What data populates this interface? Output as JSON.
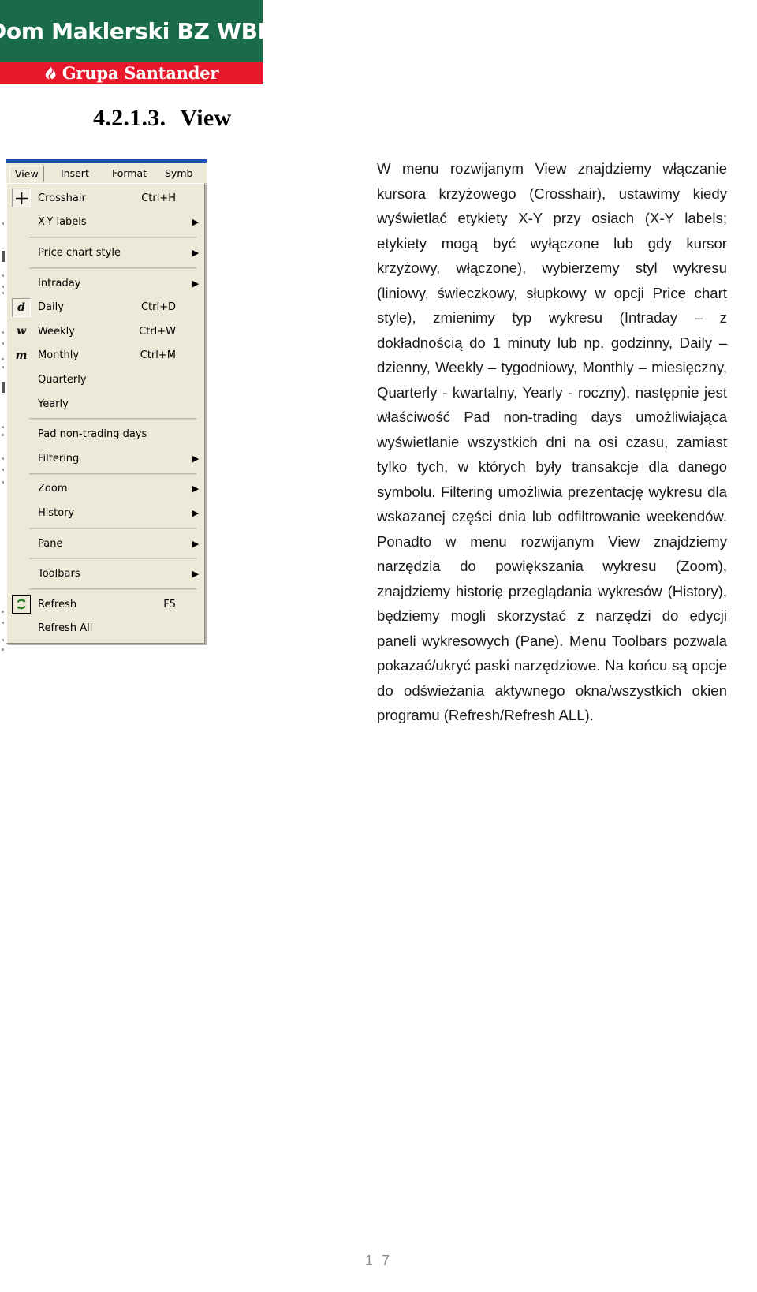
{
  "logo": {
    "green_text": "Dom Maklerski BZ WBK",
    "red_text": "Grupa Santander",
    "flame_icon": "santander-flame-icon",
    "green_color": "#1a6b4a",
    "red_color": "#e8172b"
  },
  "heading": {
    "number": "4.2.1.3.",
    "title": "View"
  },
  "app_screenshot": {
    "menubar": [
      {
        "label": "View",
        "state": "open"
      },
      {
        "label": "Insert",
        "state": "normal"
      },
      {
        "label": "Format",
        "state": "normal"
      },
      {
        "label": "Symb",
        "state": "clipped"
      }
    ],
    "dropdown_items": [
      {
        "type": "item",
        "label": "Crosshair",
        "accel": "Ctrl+H",
        "icon": "crosshair-icon",
        "icon_style": "sunken",
        "submenu": false
      },
      {
        "type": "item",
        "label": "X-Y labels",
        "accel": "",
        "icon": "",
        "submenu": true
      },
      {
        "type": "separator"
      },
      {
        "type": "item",
        "label": "Price chart style",
        "accel": "",
        "icon": "",
        "submenu": true
      },
      {
        "type": "separator"
      },
      {
        "type": "item",
        "label": "Intraday",
        "accel": "",
        "icon": "",
        "submenu": true
      },
      {
        "type": "item",
        "label": "Daily",
        "accel": "Ctrl+D",
        "icon": "daily-d-icon",
        "icon_glyph": "d",
        "icon_style": "sunken",
        "submenu": false
      },
      {
        "type": "item",
        "label": "Weekly",
        "accel": "Ctrl+W",
        "icon": "weekly-w-icon",
        "icon_glyph": "w",
        "icon_style": "plain",
        "submenu": false
      },
      {
        "type": "item",
        "label": "Monthly",
        "accel": "Ctrl+M",
        "icon": "monthly-m-icon",
        "icon_glyph": "m",
        "icon_style": "plain",
        "submenu": false
      },
      {
        "type": "item",
        "label": "Quarterly",
        "accel": "",
        "icon": "",
        "submenu": false
      },
      {
        "type": "item",
        "label": "Yearly",
        "accel": "",
        "icon": "",
        "submenu": false
      },
      {
        "type": "separator"
      },
      {
        "type": "item",
        "label": "Pad non-trading days",
        "accel": "",
        "icon": "",
        "submenu": false
      },
      {
        "type": "item",
        "label": "Filtering",
        "accel": "",
        "icon": "",
        "submenu": true
      },
      {
        "type": "separator"
      },
      {
        "type": "item",
        "label": "Zoom",
        "accel": "",
        "icon": "",
        "submenu": true
      },
      {
        "type": "item",
        "label": "History",
        "accel": "",
        "icon": "",
        "submenu": true
      },
      {
        "type": "separator"
      },
      {
        "type": "item",
        "label": "Pane",
        "accel": "",
        "icon": "",
        "submenu": true
      },
      {
        "type": "separator"
      },
      {
        "type": "item",
        "label": "Toolbars",
        "accel": "",
        "icon": "",
        "submenu": true
      },
      {
        "type": "separator"
      },
      {
        "type": "item",
        "label": "Refresh",
        "accel": "F5",
        "icon": "refresh-icon",
        "icon_style": "framed",
        "submenu": false
      },
      {
        "type": "item",
        "label": "Refresh All",
        "accel": "",
        "icon": "",
        "submenu": false
      }
    ],
    "submenu_arrow_glyph": "▶",
    "menu_background": "#ece9d8",
    "titlebar_color": "#1a53b0",
    "refresh_icon_color": "#1e7a1e"
  },
  "body": {
    "paragraph": "W menu rozwijanym View znajdziemy włączanie kursora krzyżowego (Crosshair), ustawimy kiedy wyświetlać etykiety X-Y przy osiach (X-Y labels; etykiety mogą być wyłączone lub gdy kursor krzyżowy, włączone), wybierzemy styl wykresu (liniowy, świeczkowy, słupkowy w opcji Price chart style), zmienimy typ wykresu (Intraday – z dokładnością do 1 minuty lub np. godzinny, Daily – dzienny, Weekly – tygodniowy, Monthly – miesięczny, Quarterly - kwartalny, Yearly - roczny), następnie jest właściwość Pad non-trading days umożliwiająca wyświetlanie wszystkich dni na osi czasu, zamiast tylko tych, w których były transakcje dla danego symbolu. Filtering umożliwia prezentację wykresu dla wskazanej części dnia lub odfiltrowanie weekendów. Ponadto w menu rozwijanym View znajdziemy narzędzia do powiększania wykresu (Zoom), znajdziemy historię przeglądania wykresów (History), będziemy mogli skorzystać z narzędzi do edycji paneli wykresowych (Pane). Menu Toolbars pozwala pokazać/ukryć paski narzędziowe. Na końcu są opcje do odświeżania aktywnego okna/wszystkich okien programu (Refresh/Refresh ALL)."
  },
  "footer": {
    "page_number": "1 7"
  }
}
